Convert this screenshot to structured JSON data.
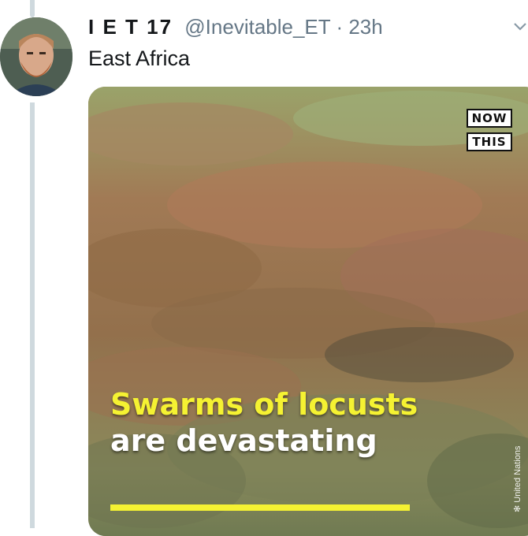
{
  "tweet": {
    "display_name": "I E T 17",
    "handle": "@Inevitable_ET",
    "separator": "·",
    "time": "23h",
    "text": "East Africa"
  },
  "media": {
    "logo_top": "NOW",
    "logo_bottom": "THIS",
    "caption_line1": "Swarms of locusts",
    "caption_line2": "are devastating",
    "credit": "United Nations",
    "accent_color": "#f5f232"
  },
  "icons": {
    "menu": "chevron-down-icon",
    "avatar": "user-avatar"
  }
}
